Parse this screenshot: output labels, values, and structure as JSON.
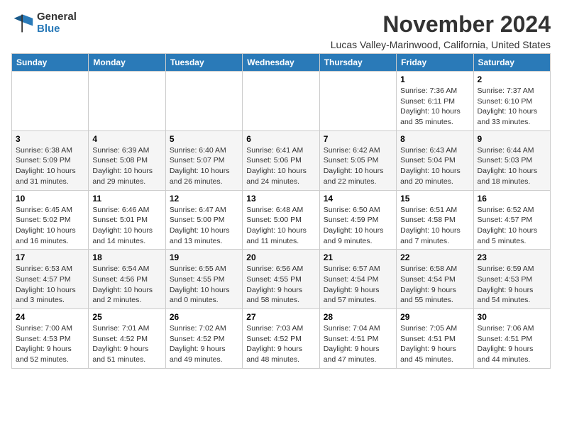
{
  "logo": {
    "general": "General",
    "blue": "Blue"
  },
  "title": "November 2024",
  "subtitle": "Lucas Valley-Marinwood, California, United States",
  "headers": [
    "Sunday",
    "Monday",
    "Tuesday",
    "Wednesday",
    "Thursday",
    "Friday",
    "Saturday"
  ],
  "weeks": [
    [
      {
        "day": "",
        "info": ""
      },
      {
        "day": "",
        "info": ""
      },
      {
        "day": "",
        "info": ""
      },
      {
        "day": "",
        "info": ""
      },
      {
        "day": "",
        "info": ""
      },
      {
        "day": "1",
        "info": "Sunrise: 7:36 AM\nSunset: 6:11 PM\nDaylight: 10 hours and 35 minutes."
      },
      {
        "day": "2",
        "info": "Sunrise: 7:37 AM\nSunset: 6:10 PM\nDaylight: 10 hours and 33 minutes."
      }
    ],
    [
      {
        "day": "3",
        "info": "Sunrise: 6:38 AM\nSunset: 5:09 PM\nDaylight: 10 hours and 31 minutes."
      },
      {
        "day": "4",
        "info": "Sunrise: 6:39 AM\nSunset: 5:08 PM\nDaylight: 10 hours and 29 minutes."
      },
      {
        "day": "5",
        "info": "Sunrise: 6:40 AM\nSunset: 5:07 PM\nDaylight: 10 hours and 26 minutes."
      },
      {
        "day": "6",
        "info": "Sunrise: 6:41 AM\nSunset: 5:06 PM\nDaylight: 10 hours and 24 minutes."
      },
      {
        "day": "7",
        "info": "Sunrise: 6:42 AM\nSunset: 5:05 PM\nDaylight: 10 hours and 22 minutes."
      },
      {
        "day": "8",
        "info": "Sunrise: 6:43 AM\nSunset: 5:04 PM\nDaylight: 10 hours and 20 minutes."
      },
      {
        "day": "9",
        "info": "Sunrise: 6:44 AM\nSunset: 5:03 PM\nDaylight: 10 hours and 18 minutes."
      }
    ],
    [
      {
        "day": "10",
        "info": "Sunrise: 6:45 AM\nSunset: 5:02 PM\nDaylight: 10 hours and 16 minutes."
      },
      {
        "day": "11",
        "info": "Sunrise: 6:46 AM\nSunset: 5:01 PM\nDaylight: 10 hours and 14 minutes."
      },
      {
        "day": "12",
        "info": "Sunrise: 6:47 AM\nSunset: 5:00 PM\nDaylight: 10 hours and 13 minutes."
      },
      {
        "day": "13",
        "info": "Sunrise: 6:48 AM\nSunset: 5:00 PM\nDaylight: 10 hours and 11 minutes."
      },
      {
        "day": "14",
        "info": "Sunrise: 6:50 AM\nSunset: 4:59 PM\nDaylight: 10 hours and 9 minutes."
      },
      {
        "day": "15",
        "info": "Sunrise: 6:51 AM\nSunset: 4:58 PM\nDaylight: 10 hours and 7 minutes."
      },
      {
        "day": "16",
        "info": "Sunrise: 6:52 AM\nSunset: 4:57 PM\nDaylight: 10 hours and 5 minutes."
      }
    ],
    [
      {
        "day": "17",
        "info": "Sunrise: 6:53 AM\nSunset: 4:57 PM\nDaylight: 10 hours and 3 minutes."
      },
      {
        "day": "18",
        "info": "Sunrise: 6:54 AM\nSunset: 4:56 PM\nDaylight: 10 hours and 2 minutes."
      },
      {
        "day": "19",
        "info": "Sunrise: 6:55 AM\nSunset: 4:55 PM\nDaylight: 10 hours and 0 minutes."
      },
      {
        "day": "20",
        "info": "Sunrise: 6:56 AM\nSunset: 4:55 PM\nDaylight: 9 hours and 58 minutes."
      },
      {
        "day": "21",
        "info": "Sunrise: 6:57 AM\nSunset: 4:54 PM\nDaylight: 9 hours and 57 minutes."
      },
      {
        "day": "22",
        "info": "Sunrise: 6:58 AM\nSunset: 4:54 PM\nDaylight: 9 hours and 55 minutes."
      },
      {
        "day": "23",
        "info": "Sunrise: 6:59 AM\nSunset: 4:53 PM\nDaylight: 9 hours and 54 minutes."
      }
    ],
    [
      {
        "day": "24",
        "info": "Sunrise: 7:00 AM\nSunset: 4:53 PM\nDaylight: 9 hours and 52 minutes."
      },
      {
        "day": "25",
        "info": "Sunrise: 7:01 AM\nSunset: 4:52 PM\nDaylight: 9 hours and 51 minutes."
      },
      {
        "day": "26",
        "info": "Sunrise: 7:02 AM\nSunset: 4:52 PM\nDaylight: 9 hours and 49 minutes."
      },
      {
        "day": "27",
        "info": "Sunrise: 7:03 AM\nSunset: 4:52 PM\nDaylight: 9 hours and 48 minutes."
      },
      {
        "day": "28",
        "info": "Sunrise: 7:04 AM\nSunset: 4:51 PM\nDaylight: 9 hours and 47 minutes."
      },
      {
        "day": "29",
        "info": "Sunrise: 7:05 AM\nSunset: 4:51 PM\nDaylight: 9 hours and 45 minutes."
      },
      {
        "day": "30",
        "info": "Sunrise: 7:06 AM\nSunset: 4:51 PM\nDaylight: 9 hours and 44 minutes."
      }
    ]
  ]
}
